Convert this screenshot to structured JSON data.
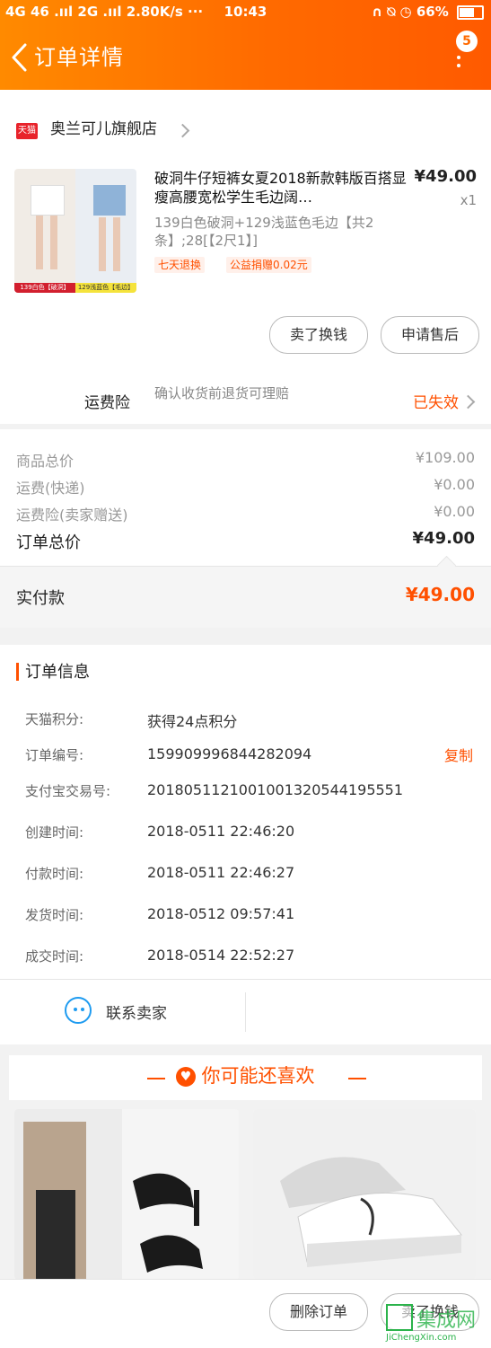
{
  "status_bar": {
    "left": "4G 46 .ııl 2G .ııl 2.80K/s ···",
    "time": "10:43",
    "right": "∩ ⍉ ◷ 66%"
  },
  "header": {
    "title": "订单详情",
    "message_count": "5"
  },
  "shop": {
    "badge": "天猫",
    "name": "奥兰可儿旗舰店"
  },
  "product": {
    "name": "破洞牛仔短裤女夏2018新款韩版百搭显瘦高腰宽松学生毛边阔…",
    "price": "¥49.00",
    "qty": "x1",
    "sku": "139白色破洞+129浅蓝色毛边【共2条】;28[【2尺1】]",
    "tags": [
      "七天退换",
      "公益捐赠0.02元"
    ],
    "thumb_labels": [
      "139白色【破洞】",
      "129浅蓝色【毛边】"
    ]
  },
  "item_actions": {
    "sell_button": "卖了换钱",
    "after_sale_button": "申请售后"
  },
  "insurance": {
    "label": "运费险",
    "desc": "确认收货前退货可理赔",
    "status": "已失效"
  },
  "price_summary": {
    "rows": [
      {
        "label": "商品总价",
        "value": "¥109.00"
      },
      {
        "label": "运费(快递)",
        "value": "¥0.00"
      },
      {
        "label": "运费险(卖家赠送)",
        "value": "¥0.00"
      }
    ],
    "total_label": "订单总价",
    "total_value": "¥49.00",
    "paid_label": "实付款",
    "paid_value": "¥49.00"
  },
  "order_info": {
    "title": "订单信息",
    "rows": [
      {
        "label": "天猫积分:",
        "value": "获得24点积分"
      },
      {
        "label": "订单编号:",
        "value": "159909996844282094"
      },
      {
        "label": "支付宝交易号:",
        "value": "2018051121001001320544195551"
      },
      {
        "label": "创建时间:",
        "value": "2018-0511 22:46:20"
      },
      {
        "label": "付款时间:",
        "value": "2018-0511 22:46:27"
      },
      {
        "label": "发货时间:",
        "value": "2018-0512 09:57:41"
      },
      {
        "label": "成交时间:",
        "value": "2018-0514 22:52:27"
      }
    ],
    "copy_label": "复制"
  },
  "contact": {
    "label": "联系卖家",
    "icon": "wangwang-icon"
  },
  "recommend": {
    "title": "你可能还喜欢"
  },
  "bottom_bar": {
    "delete_button": "删除订单",
    "sell_button": "卖了换钱"
  },
  "watermark": {
    "text": "集成网",
    "sub": "JiChengXin.com"
  },
  "colors": {
    "accent": "#ff5000",
    "header_start": "#ff8a00",
    "header_end": "#ff5a00",
    "tmall": "#e8232b",
    "wangwang": "#1e9bf0"
  }
}
